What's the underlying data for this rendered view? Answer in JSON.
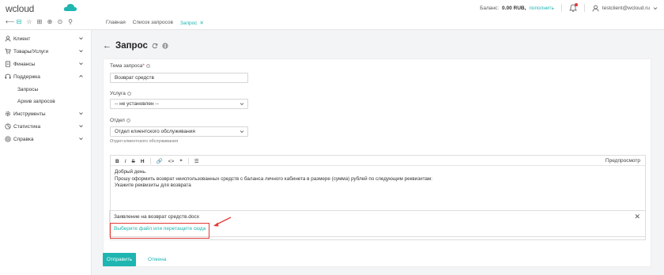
{
  "header": {
    "logo": "wcloud",
    "balance_label": "Баланс:",
    "balance_value": "0.00 RUB,",
    "topup_label": "пополнить",
    "user_email": "testclient@wcloud.ru"
  },
  "tabs": [
    {
      "label": "Главная"
    },
    {
      "label": "Список запросов"
    },
    {
      "label": "Запрос",
      "close": "✕"
    }
  ],
  "sidebar": {
    "items": [
      {
        "label": "Клиент",
        "icon": "user-icon"
      },
      {
        "label": "Товары/Услуги",
        "icon": "cart-icon"
      },
      {
        "label": "Финансы",
        "icon": "document-icon"
      },
      {
        "label": "Поддержка",
        "icon": "headset-icon"
      },
      {
        "label": "Инструменты",
        "icon": "gear-icon"
      },
      {
        "label": "Статистика",
        "icon": "chart-icon"
      },
      {
        "label": "Справка",
        "icon": "help-icon"
      }
    ],
    "sub_items": [
      {
        "label": "Запросы"
      },
      {
        "label": "Архив запросов"
      }
    ]
  },
  "page": {
    "back": "←",
    "title": "Запрос"
  },
  "form": {
    "subject_label": "Тема запроса",
    "subject_required": "*",
    "subject_value": "Возврат средств",
    "service_label": "Услуга",
    "service_value": "-- не установлен --",
    "dept_label": "Отдел",
    "dept_value": "Отдел клиентского обслуживания",
    "dept_hint": "Отдел клиентского обслуживания"
  },
  "editor": {
    "toolbar": [
      "B",
      "I",
      "S",
      "H",
      "🔗",
      "<>",
      "❝",
      "☰"
    ],
    "preview_label": "Предпросмотр",
    "lines": [
      "Добрый день.",
      "Прошу оформить возврат неиспользованных средств с баланса личного кабинета в размере (сумма) рублей по следующим реквизитам:",
      "Укажите реквизиты для возврата"
    ]
  },
  "attachment": {
    "file_name": "Заявление на возврат средств.docx",
    "remove": "✕",
    "choose_label": "Выберите файл или перетащите сюда"
  },
  "actions": {
    "send_label": "Отправить",
    "cancel_label": "Отмена"
  },
  "colors": {
    "accent": "#1fb5b0",
    "highlight": "#e53935"
  }
}
